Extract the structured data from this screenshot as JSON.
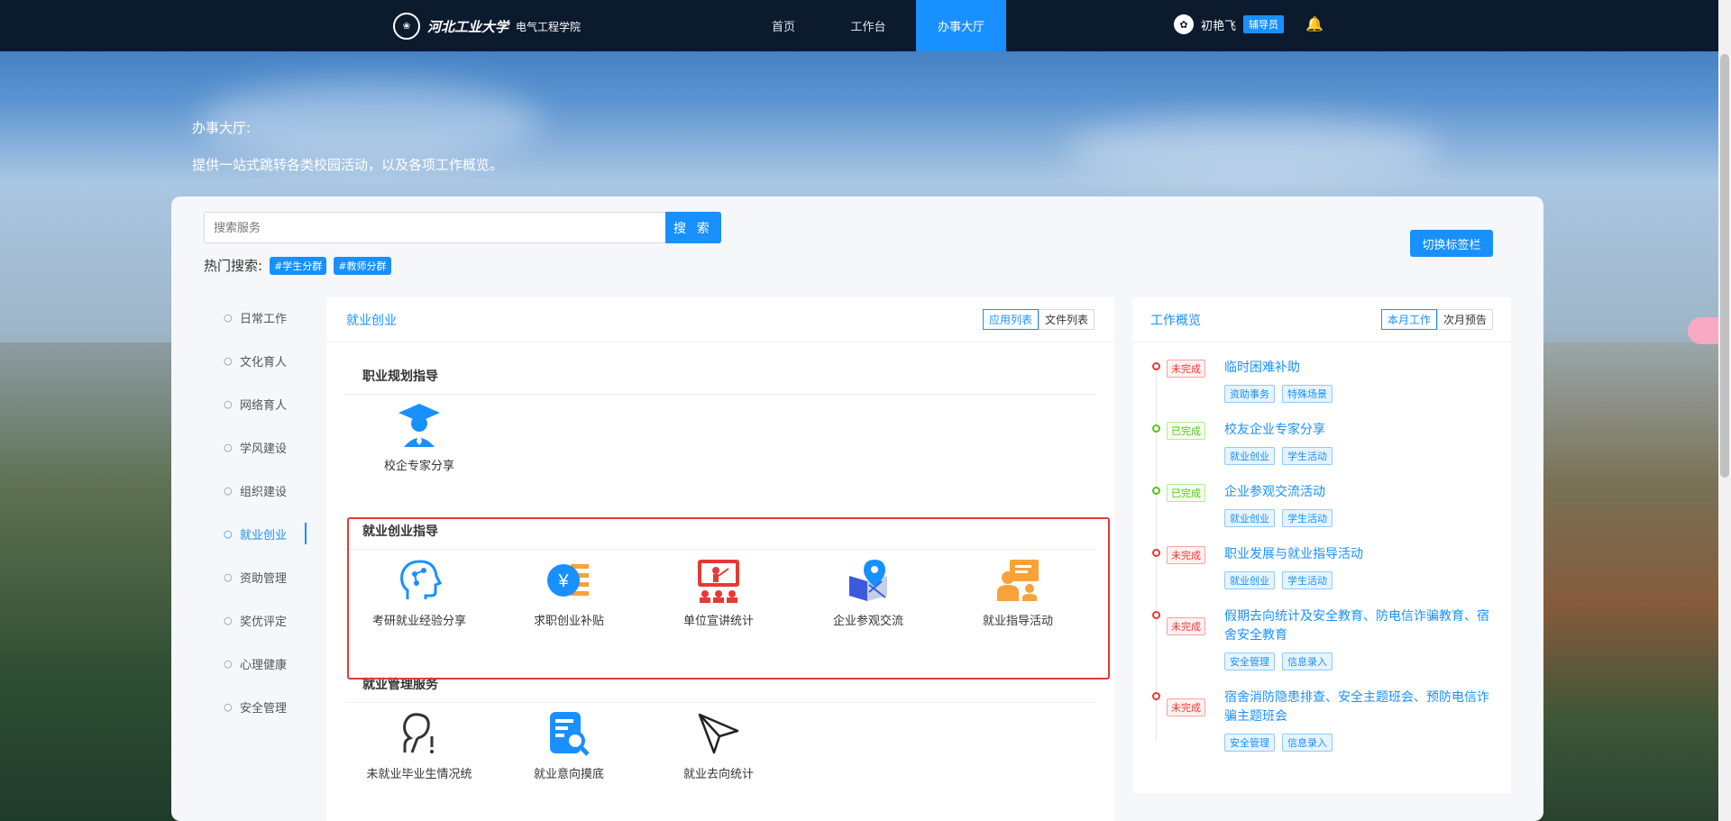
{
  "header": {
    "school_logo_text": "河北工业大学",
    "school_seal": "河北工业大学",
    "college": "电气工程学院",
    "nav": [
      {
        "label": "首页",
        "active": false
      },
      {
        "label": "工作台",
        "active": false
      },
      {
        "label": "办事大厅",
        "active": true
      }
    ],
    "user_name": "初艳飞",
    "role": "辅导员",
    "icons": {
      "avatar": "user-avatar-icon",
      "bell": "bell-icon"
    }
  },
  "hero": {
    "title": "办事大厅:",
    "description": "提供一站式跳转各类校园活动，以及各项工作概览。"
  },
  "search": {
    "placeholder": "搜索服务",
    "button_label": "搜 索",
    "hot_label": "热门搜索:",
    "hot_tags": [
      "#学生分群",
      "#教师分群"
    ]
  },
  "switch_button": "切换标签栏",
  "sidebar": {
    "items": [
      {
        "label": "日常工作",
        "active": false
      },
      {
        "label": "文化育人",
        "active": false
      },
      {
        "label": "网络育人",
        "active": false
      },
      {
        "label": "学风建设",
        "active": false
      },
      {
        "label": "组织建设",
        "active": false
      },
      {
        "label": "就业创业",
        "active": true
      },
      {
        "label": "资助管理",
        "active": false
      },
      {
        "label": "奖优评定",
        "active": false
      },
      {
        "label": "心理健康",
        "active": false
      },
      {
        "label": "安全管理",
        "active": false
      }
    ]
  },
  "center": {
    "title": "就业创业",
    "views": [
      "应用列表",
      "文件列表"
    ],
    "active_view": "应用列表",
    "sections": [
      {
        "title": "职业规划指导",
        "apps": [
          {
            "label": "校企专家分享",
            "icon": "graduate-icon"
          }
        ]
      },
      {
        "title": "就业创业指导",
        "apps": [
          {
            "label": "考研就业经验分享",
            "icon": "brain-network-icon"
          },
          {
            "label": "求职创业补贴",
            "icon": "yen-coin-icon"
          },
          {
            "label": "单位宣讲统计",
            "icon": "presentation-board-icon"
          },
          {
            "label": "企业参观交流",
            "icon": "map-pin-icon"
          },
          {
            "label": "就业指导活动",
            "icon": "teacher-board-icon"
          }
        ]
      },
      {
        "title": "就业管理服务",
        "apps": [
          {
            "label": "未就业毕业生情况统",
            "icon": "person-alert-icon"
          },
          {
            "label": "就业意向摸底",
            "icon": "document-search-icon"
          },
          {
            "label": "就业去向统计",
            "icon": "paper-plane-icon"
          }
        ]
      }
    ]
  },
  "overview": {
    "title": "工作概览",
    "tabs": [
      "本月工作",
      "次月预告"
    ],
    "active_tab": "本月工作",
    "items": [
      {
        "status": "未完成",
        "done": false,
        "title": "临时困难补助",
        "tags": [
          "资助事务",
          "特殊场景"
        ]
      },
      {
        "status": "已完成",
        "done": true,
        "title": "校友企业专家分享",
        "tags": [
          "就业创业",
          "学生活动"
        ]
      },
      {
        "status": "已完成",
        "done": true,
        "title": "企业参观交流活动",
        "tags": [
          "就业创业",
          "学生活动"
        ]
      },
      {
        "status": "未完成",
        "done": false,
        "title": "职业发展与就业指导活动",
        "tags": [
          "就业创业",
          "学生活动"
        ]
      },
      {
        "status": "未完成",
        "done": false,
        "title": "假期去向统计及安全教育、防电信诈骗教育、宿舍安全教育",
        "tags": [
          "安全管理",
          "信息录入"
        ]
      },
      {
        "status": "未完成",
        "done": false,
        "title": "宿舍消防隐患排查、安全主题班会、预防电信诈骗主题班会",
        "tags": [
          "安全管理",
          "信息录入"
        ]
      }
    ]
  },
  "colors": {
    "primary": "#1890ff",
    "nav_bg": "#0c1a2e",
    "danger": "#e53935",
    "success": "#52c41a"
  }
}
